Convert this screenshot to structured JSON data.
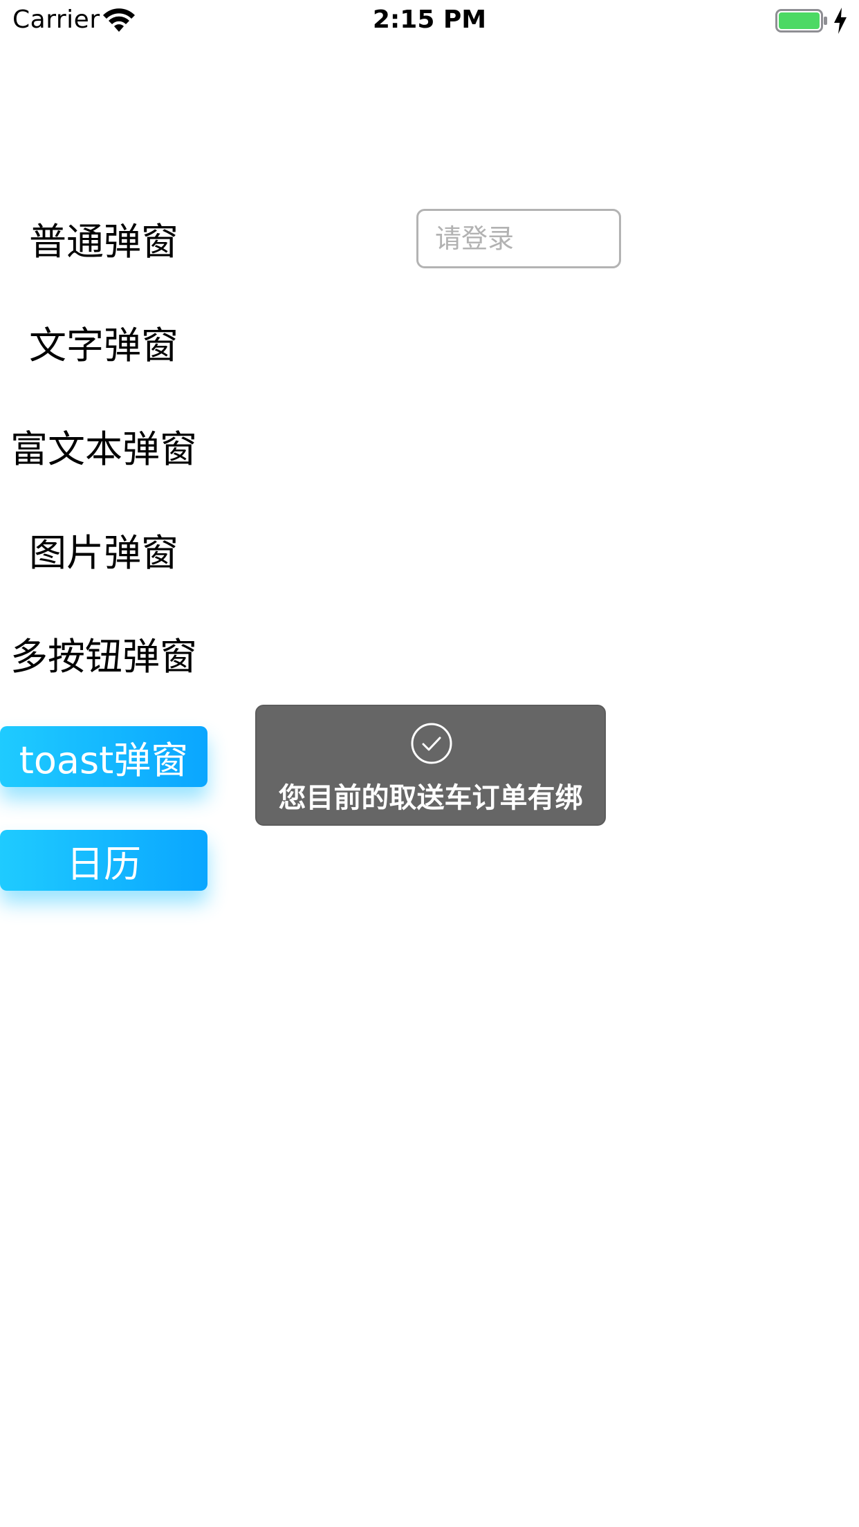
{
  "status_bar": {
    "carrier": "Carrier",
    "time": "2:15 PM",
    "battery_color": "#4cd964"
  },
  "menu": {
    "normal_popup": "普通弹窗",
    "text_popup": "文字弹窗",
    "rich_text_popup": "富文本弹窗",
    "image_popup": "图片弹窗",
    "multi_button_popup": "多按钮弹窗",
    "toast_popup": "toast弹窗",
    "calendar": "日历"
  },
  "login": {
    "placeholder": "请登录",
    "value": ""
  },
  "toast": {
    "icon": "checkmark-circle-icon",
    "message": "您目前的取送车订单有绑"
  },
  "colors": {
    "button_gradient_start": "#1fcbff",
    "button_gradient_end": "#0aa6ff",
    "toast_background": "#666666"
  }
}
